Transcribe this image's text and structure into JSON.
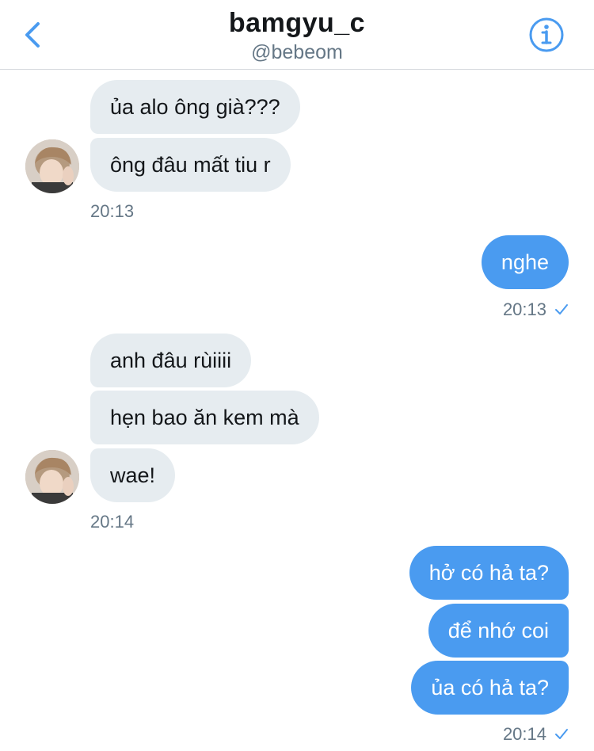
{
  "header": {
    "name": "bamgyu_c",
    "handle": "@bebeom"
  },
  "messages": [
    {
      "side": "in",
      "text": "ủa alo ông già???"
    },
    {
      "side": "in",
      "text": "ông đâu mất tiu r"
    },
    {
      "side": "time-in",
      "text": "20:13"
    },
    {
      "side": "out",
      "text": "nghe"
    },
    {
      "side": "time-out",
      "text": "20:13"
    },
    {
      "side": "in",
      "text": "anh đâu rùiiii"
    },
    {
      "side": "in",
      "text": "hẹn bao ăn kem mà"
    },
    {
      "side": "in",
      "text": "wae!"
    },
    {
      "side": "time-in",
      "text": "20:14"
    },
    {
      "side": "out",
      "text": "hở có hả ta?"
    },
    {
      "side": "out",
      "text": "để nhớ coi"
    },
    {
      "side": "out",
      "text": "ủa có hả ta?"
    },
    {
      "side": "time-out",
      "text": "20:14"
    }
  ],
  "colors": {
    "accent": "#4a9bf0",
    "incoming_bubble": "#e6ecf0",
    "muted_text": "#657786"
  },
  "icons": [
    "chevron-left-icon",
    "info-icon",
    "checkmark-icon"
  ]
}
